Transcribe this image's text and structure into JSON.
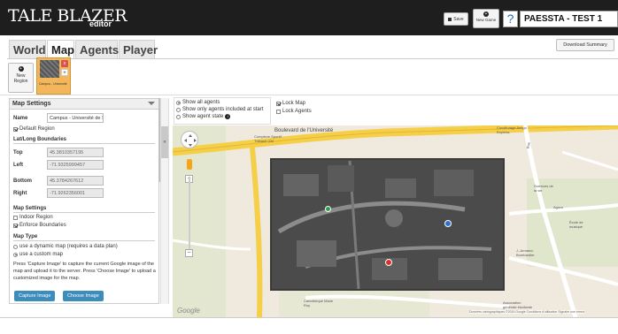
{
  "app": {
    "logo": "TALE BLAZER",
    "subtitle": "editor"
  },
  "toolbar": {
    "save_label": "Save",
    "new_game_label": "New Game",
    "help_glyph": "?",
    "game_title": "PAESSTA - TEST 1"
  },
  "tabs": [
    {
      "label": "World",
      "active": false
    },
    {
      "label": "Map",
      "active": true
    },
    {
      "label": "Agents",
      "active": false
    },
    {
      "label": "Player",
      "active": false
    }
  ],
  "download_summary": "Download Summary",
  "regions": {
    "new_label": "New Region",
    "items": [
      {
        "name": "Campus - Université"
      }
    ]
  },
  "settings": {
    "header": "Map Settings",
    "name_label": "Name",
    "name_value": "Campus - Université de S",
    "default_region": "Default Region",
    "latlong_header": "Lat/Long Boundaries",
    "top_label": "Top",
    "top_value": "45.3810357195",
    "left_label": "Left",
    "left_value": "-71.9325999457",
    "bottom_label": "Bottom",
    "bottom_value": "45.3784267612",
    "right_label": "Right",
    "right_value": "-71.9262356001",
    "map_settings_header": "Map Settings",
    "indoor_region": "Indoor Region",
    "enforce_boundaries": "Enforce Boundaries",
    "map_type_header": "Map Type",
    "dynamic_map": "use a dynamic map (requires a data plan)",
    "custom_map": "use a custom map",
    "help_text": "Press 'Capture Image' to capture the current Google image of the map and upload it to the server. Press 'Choose Image' to upload a customized image for the map.",
    "capture_button": "Capture Image",
    "choose_button": "Choose Image"
  },
  "map_options": {
    "show_all_agents": "Show all agents",
    "show_only_included": "Show only agents included at start",
    "show_agent_state": "Show agent state",
    "lock_map": "Lock Map",
    "lock_agents": "Lock Agents"
  },
  "map": {
    "road_label": "Boulevard de l'Université",
    "labels": {
      "complexe": "Complexe Sportif Thibault GM",
      "covoiturage": "Covoiturage Amigo Express",
      "sciences": "Sciences de la vie",
      "agora": "Agora",
      "ecole": "École de musique",
      "armand": "J.-Armand-Bombardier",
      "cartotheque": "Cartothèque Marie Roy",
      "association": "Association générale étudiante",
      "rue": "Rue"
    },
    "google": "Google",
    "copyright": "Données cartographiques ©2015 Google   Conditions d'utilisation   Signaler une erreur"
  },
  "colors": {
    "topbar": "#1e1e1e",
    "region_tile": "#f3b65a",
    "button_primary": "#3c8dbc",
    "map_background": "#efe9de",
    "road_yellow": "#f5cf47"
  }
}
